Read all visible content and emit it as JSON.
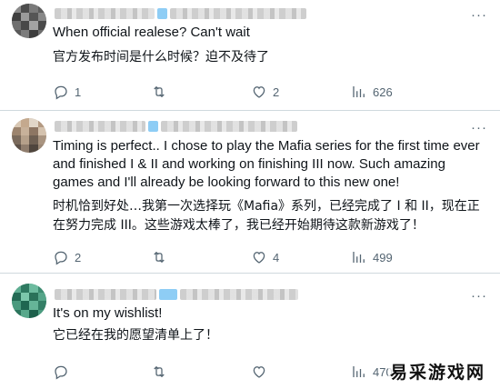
{
  "posts": [
    {
      "text_en": "When official realese? Can't wait",
      "text_cn": "官方发布时间是什么时候？迫不及待了",
      "stats": {
        "replies": "1",
        "retweets": "",
        "likes": "2",
        "views": "626"
      }
    },
    {
      "text_en": "Timing is perfect.. I chose to play the Mafia series for the first time ever and finished I & II and working on finishing III now. Such amazing games and I'll already be looking forward to this new one!",
      "text_cn": "时机恰到好处…我第一次选择玩《Mafia》系列，已经完成了 I 和 II，现在正在努力完成 III。这些游戏太棒了，我已经开始期待这款新游戏了！",
      "stats": {
        "replies": "2",
        "retweets": "",
        "likes": "4",
        "views": "499"
      }
    },
    {
      "text_en": "It's on my wishlist!",
      "text_cn": "它已经在我的愿望清单上了！",
      "stats": {
        "replies": "",
        "retweets": "",
        "likes": "",
        "views": "470"
      }
    }
  ],
  "more_glyph": "···",
  "watermark": "易采游戏网",
  "icons": [
    "reply-icon",
    "retweet-icon",
    "like-icon",
    "views-icon",
    "more-icon"
  ],
  "colors": {
    "text": "#0f1419",
    "muted": "#536471",
    "divider": "#cfd9de",
    "blur_accent": "#8ecdf5"
  }
}
